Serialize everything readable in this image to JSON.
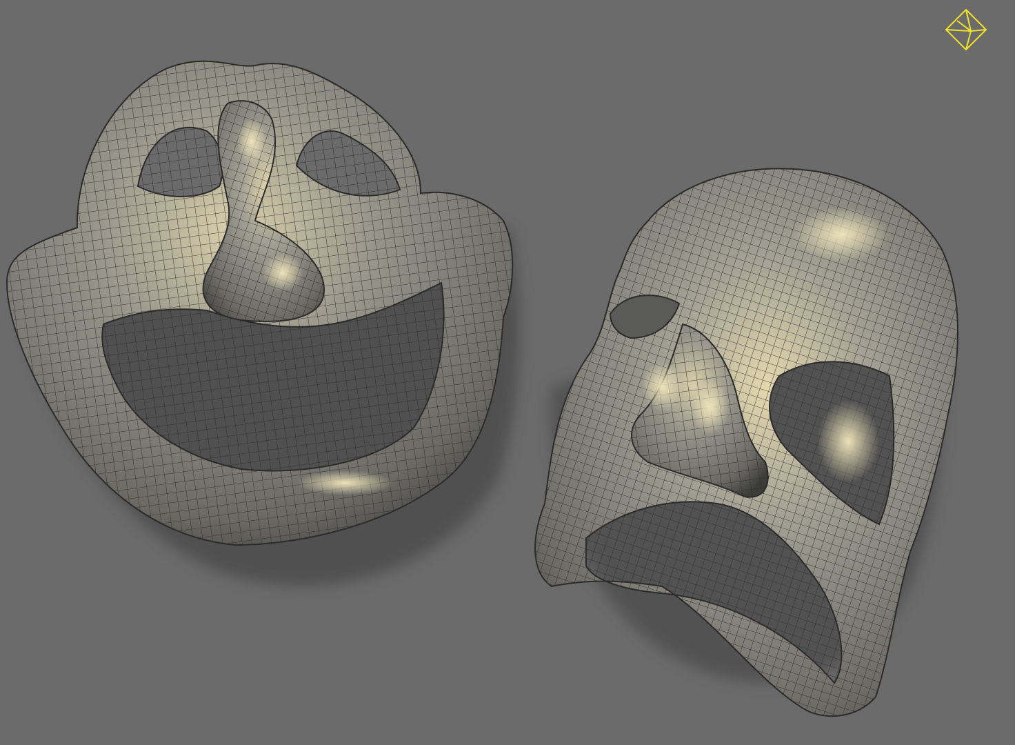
{
  "viewport": {
    "background_color": "#6b6b6b",
    "shading": "smooth-shaded-with-wireframe",
    "mesh_color": "#8d8c86",
    "wire_color": "#2b2b2b",
    "highlight_color": "#e8dcb0"
  },
  "objects": [
    {
      "name": "comedy-mask",
      "expression": "smiling"
    },
    {
      "name": "tragedy-mask",
      "expression": "frowning"
    }
  ],
  "view_gizmo": {
    "icon": "octahedron-view-cube-icon",
    "color": "#f2e32a"
  }
}
